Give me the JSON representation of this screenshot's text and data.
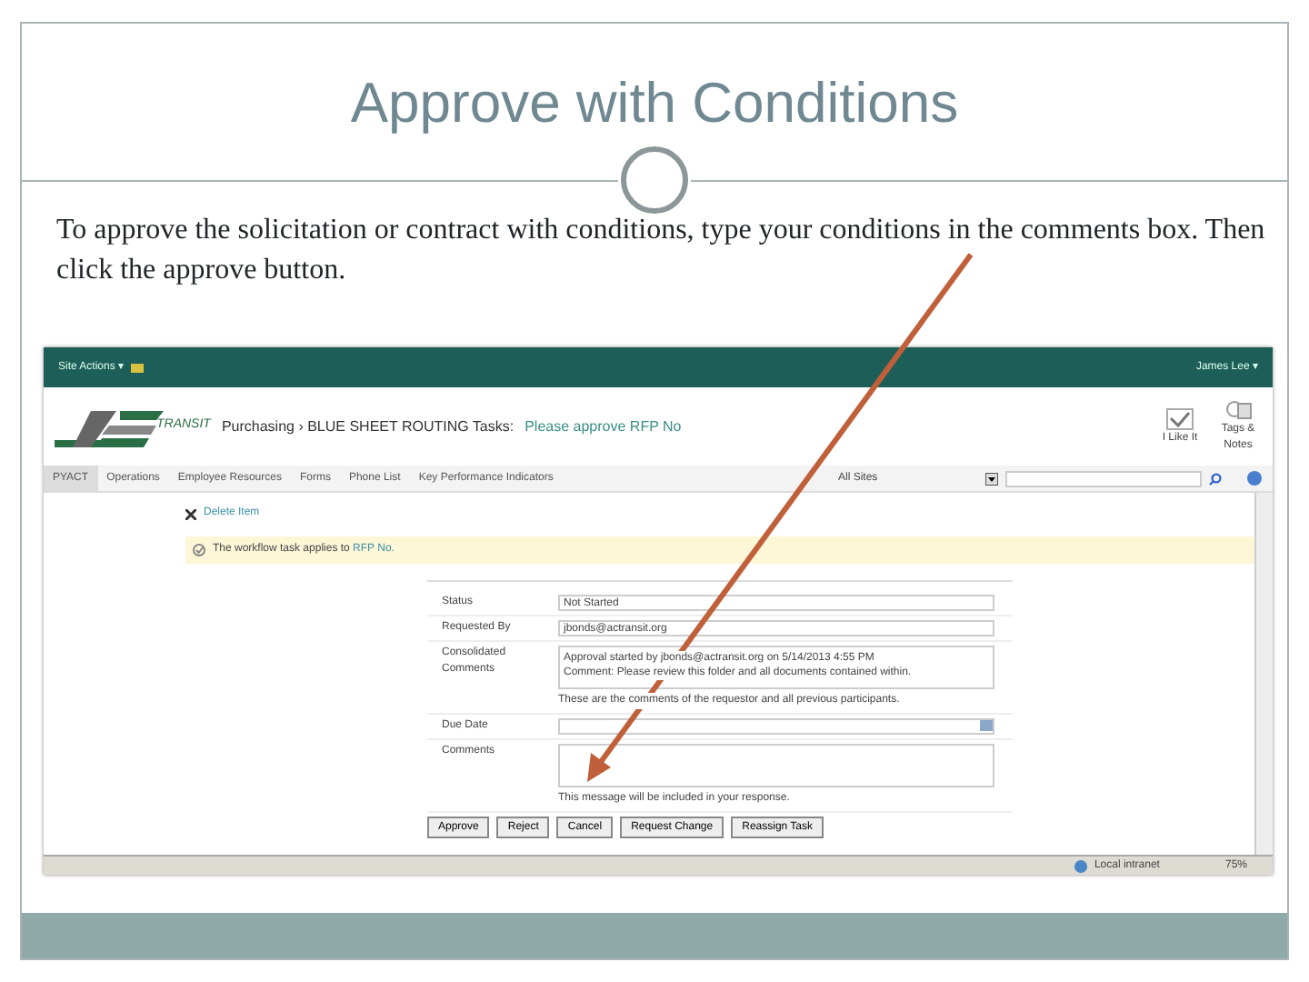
{
  "slide": {
    "title": "Approve with Conditions",
    "body": "To approve the solicitation or contract with conditions, type your conditions in the comments box. Then click the approve button."
  },
  "screenshot": {
    "top_bar": {
      "site_actions": "Site Actions ▾",
      "user": "James Lee ▾"
    },
    "header": {
      "logo_text": "TRANSIT",
      "breadcrumb": "Purchasing › BLUE SHEET ROUTING Tasks:",
      "page_title": "Please approve RFP No",
      "actions": [
        {
          "label": "I Like It",
          "kind": "like"
        },
        {
          "label": "Tags & Notes",
          "kind": "tags"
        }
      ]
    },
    "nav": {
      "tabs": [
        {
          "label": "PYACT",
          "selected": true
        },
        {
          "label": "Operations",
          "selected": false
        },
        {
          "label": "Employee Resources",
          "selected": false
        },
        {
          "label": "Forms",
          "selected": false
        },
        {
          "label": "Phone List",
          "selected": false
        },
        {
          "label": "Key Performance Indicators",
          "selected": false
        }
      ],
      "scope": "All Sites"
    },
    "toolbar": {
      "delete": "Delete Item"
    },
    "notice": {
      "text": "The workflow task applies to",
      "link": "RFP No."
    },
    "form": {
      "rows": [
        {
          "label": "Status",
          "kind": "text",
          "value": "Not Started"
        },
        {
          "label": "Requested By",
          "kind": "text",
          "value": "jbonds@actransit.org"
        },
        {
          "label": "Consolidated Comments",
          "kind": "textarea",
          "lines": [
            "Approval started by jbonds@actransit.org on 5/14/2013 4:55 PM",
            "Comment: Please review this folder and all documents contained within."
          ],
          "hint": "These are the comments of the requestor and all previous participants."
        },
        {
          "label": "Due Date",
          "kind": "date"
        },
        {
          "label": "Comments",
          "kind": "textarea",
          "hint": "This message will be included in your response."
        }
      ],
      "buttons": [
        "Approve",
        "Reject",
        "Cancel",
        "Request Change",
        "Reassign Task"
      ]
    },
    "status_bar": {
      "zone": "Local intranet",
      "zoom": "75%"
    }
  }
}
